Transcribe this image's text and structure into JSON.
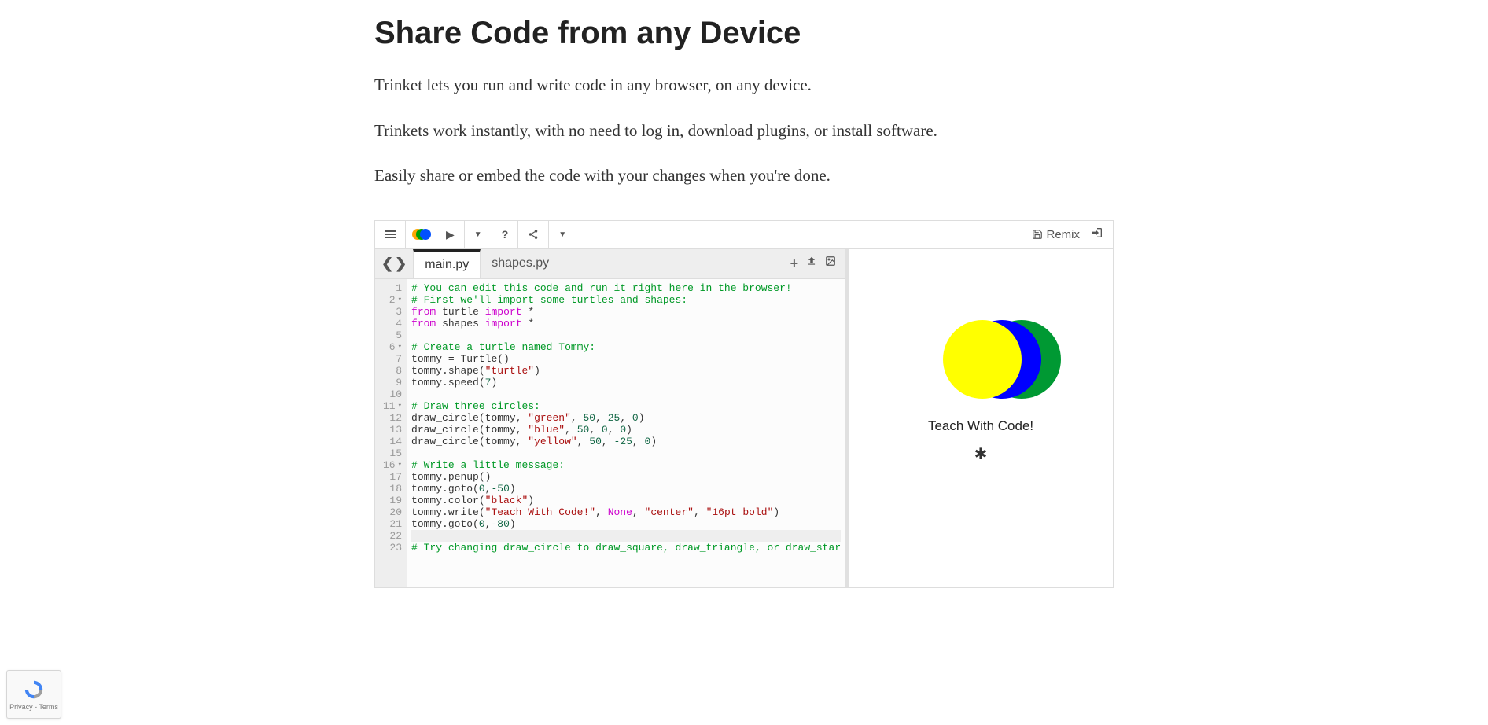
{
  "page": {
    "title": "Share Code from any Device",
    "intro": [
      "Trinket lets you run and write code in any browser, on any device.",
      "Trinkets work instantly, with no need to log in, download plugins, or install software.",
      "Easily share or embed the code with your changes when you're done."
    ]
  },
  "toolbar": {
    "remix_label": "Remix"
  },
  "tabs": {
    "active": "main.py",
    "inactive": "shapes.py"
  },
  "code": {
    "lines": [
      {
        "n": "1",
        "fold": "",
        "html": "<span class='cm-comment'># You can edit this code and run it right here in the browser!</span>"
      },
      {
        "n": "2",
        "fold": "▾",
        "html": "<span class='cm-comment'># First we'll import some turtles and shapes:</span>"
      },
      {
        "n": "3",
        "fold": "",
        "html": "<span class='cm-keyword'>from</span> <span class='cm-var'>turtle</span> <span class='cm-keyword'>import</span> <span class='cm-var'>*</span>"
      },
      {
        "n": "4",
        "fold": "",
        "html": "<span class='cm-keyword'>from</span> <span class='cm-var'>shapes</span> <span class='cm-keyword'>import</span> <span class='cm-var'>*</span>"
      },
      {
        "n": "5",
        "fold": "",
        "html": ""
      },
      {
        "n": "6",
        "fold": "▾",
        "html": "<span class='cm-comment'># Create a turtle named Tommy:</span>"
      },
      {
        "n": "7",
        "fold": "",
        "html": "<span class='cm-var'>tommy = Turtle()</span>"
      },
      {
        "n": "8",
        "fold": "",
        "html": "<span class='cm-var'>tommy.shape(</span><span class='cm-string'>\"turtle\"</span><span class='cm-var'>)</span>"
      },
      {
        "n": "9",
        "fold": "",
        "html": "<span class='cm-var'>tommy.speed(</span><span class='cm-num'>7</span><span class='cm-var'>)</span>"
      },
      {
        "n": "10",
        "fold": "",
        "html": ""
      },
      {
        "n": "11",
        "fold": "▾",
        "html": "<span class='cm-comment'># Draw three circles:</span>"
      },
      {
        "n": "12",
        "fold": "",
        "html": "<span class='cm-var'>draw_circle(tommy, </span><span class='cm-string'>\"green\"</span><span class='cm-var'>, </span><span class='cm-num'>50</span><span class='cm-var'>, </span><span class='cm-num'>25</span><span class='cm-var'>, </span><span class='cm-num'>0</span><span class='cm-var'>)</span>"
      },
      {
        "n": "13",
        "fold": "",
        "html": "<span class='cm-var'>draw_circle(tommy, </span><span class='cm-string'>\"blue\"</span><span class='cm-var'>, </span><span class='cm-num'>50</span><span class='cm-var'>, </span><span class='cm-num'>0</span><span class='cm-var'>, </span><span class='cm-num'>0</span><span class='cm-var'>)</span>"
      },
      {
        "n": "14",
        "fold": "",
        "html": "<span class='cm-var'>draw_circle(tommy, </span><span class='cm-string'>\"yellow\"</span><span class='cm-var'>, </span><span class='cm-num'>50</span><span class='cm-var'>, </span><span class='cm-num'>-25</span><span class='cm-var'>, </span><span class='cm-num'>0</span><span class='cm-var'>)</span>"
      },
      {
        "n": "15",
        "fold": "",
        "html": ""
      },
      {
        "n": "16",
        "fold": "▾",
        "html": "<span class='cm-comment'># Write a little message:</span>"
      },
      {
        "n": "17",
        "fold": "",
        "html": "<span class='cm-var'>tommy.penup()</span>"
      },
      {
        "n": "18",
        "fold": "",
        "html": "<span class='cm-var'>tommy.goto(</span><span class='cm-num'>0</span><span class='cm-var'>,</span><span class='cm-num'>-50</span><span class='cm-var'>)</span>"
      },
      {
        "n": "19",
        "fold": "",
        "html": "<span class='cm-var'>tommy.color(</span><span class='cm-string'>\"black\"</span><span class='cm-var'>)</span>"
      },
      {
        "n": "20",
        "fold": "",
        "html": "<span class='cm-var'>tommy.write(</span><span class='cm-string'>\"Teach With Code!\"</span><span class='cm-var'>, </span><span class='cm-none'>None</span><span class='cm-var'>, </span><span class='cm-string'>\"center\"</span><span class='cm-var'>, </span><span class='cm-string'>\"16pt bold\"</span><span class='cm-var'>)</span>"
      },
      {
        "n": "21",
        "fold": "",
        "html": "<span class='cm-var'>tommy.goto(</span><span class='cm-num'>0</span><span class='cm-var'>,</span><span class='cm-num'>-80</span><span class='cm-var'>)</span>"
      },
      {
        "n": "22",
        "fold": "",
        "html": "",
        "current": true
      },
      {
        "n": "23",
        "fold": "",
        "html": "<span class='cm-comment'># Try changing draw_circle to draw_square, draw_triangle, or draw_star</span>"
      }
    ]
  },
  "output": {
    "message": "Teach With Code!"
  },
  "recaptcha": {
    "label": "Privacy - Terms"
  }
}
